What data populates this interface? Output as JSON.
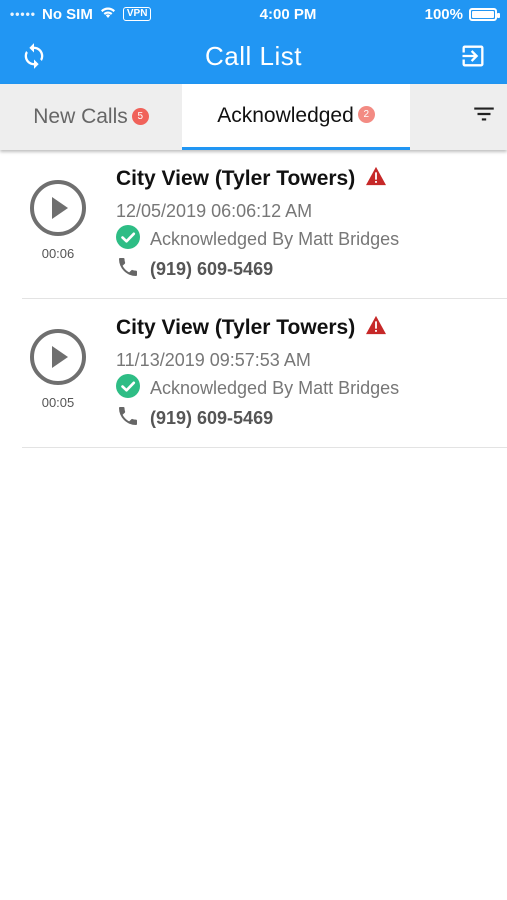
{
  "status_bar": {
    "carrier": "No SIM",
    "vpn": "VPN",
    "time": "4:00 PM",
    "battery": "100%",
    "battery_level": 1.0
  },
  "header": {
    "title": "Call List",
    "left_icon": "refresh-icon",
    "right_icon": "logout-icon"
  },
  "tabs": [
    {
      "label": "New Calls",
      "badge": "5"
    },
    {
      "label": "Acknowledged",
      "badge": "2"
    }
  ],
  "filter_icon": "filter-icon",
  "calls": [
    {
      "location": "City View (Tyler Towers)",
      "timestamp": "12/05/2019 06:06:12 AM",
      "status": "Acknowledged By Matt Bridges",
      "phone": "(919) 609-5469",
      "duration": "00:06"
    },
    {
      "location": "City View (Tyler Towers)",
      "timestamp": "11/13/2019 09:57:53 AM",
      "status": "Acknowledged By Matt Bridges",
      "phone": "(919) 609-5469",
      "duration": "00:05"
    }
  ],
  "colors": {
    "primary": "#2196F3",
    "badge": "#f0625a",
    "check": "#2ebd85",
    "warning": "#c62828"
  }
}
